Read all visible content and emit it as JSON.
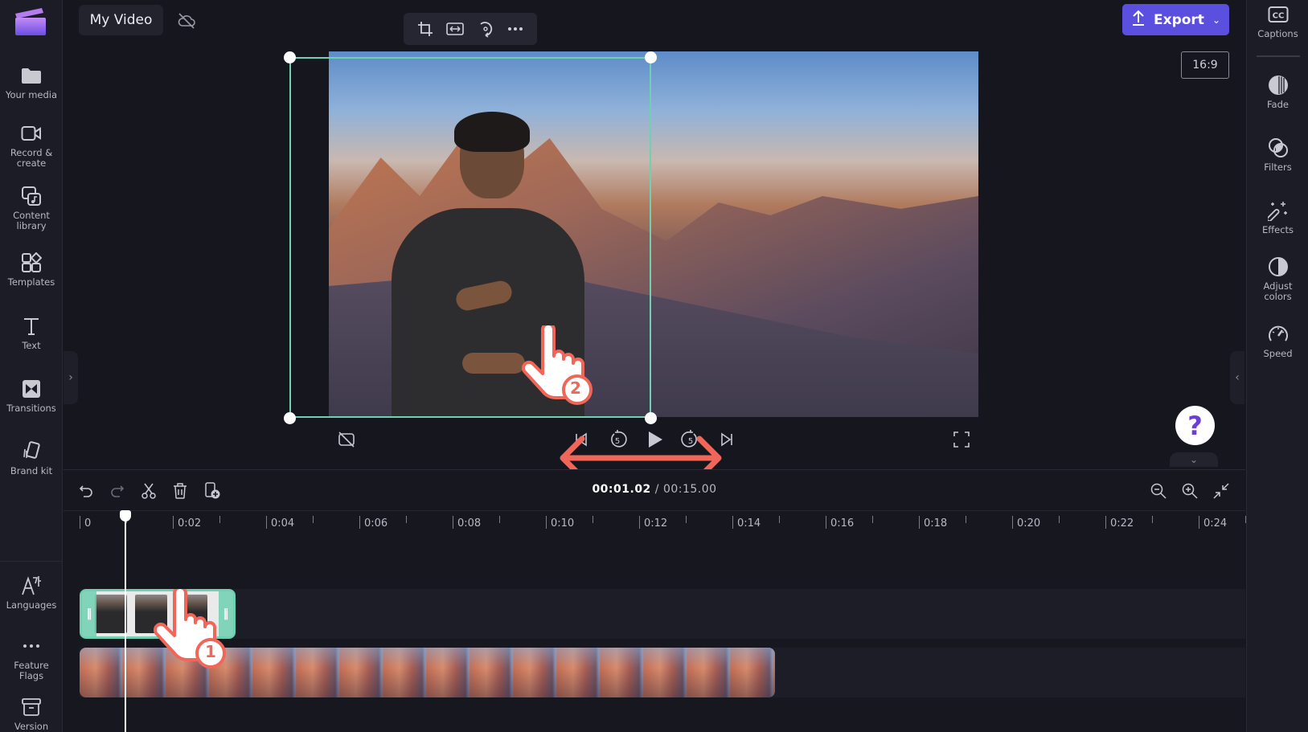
{
  "app": {
    "project_title": "My Video",
    "cloud_status_icon": "cloud-off-icon"
  },
  "left_sidebar": {
    "items": [
      {
        "label": "Your media",
        "icon": "folder-icon"
      },
      {
        "label": "Record &\ncreate",
        "icon": "video-camera-icon"
      },
      {
        "label": "Content\nlibrary",
        "icon": "content-library-icon"
      },
      {
        "label": "Templates",
        "icon": "templates-icon"
      },
      {
        "label": "Text",
        "icon": "text-icon"
      },
      {
        "label": "Transitions",
        "icon": "transitions-icon"
      },
      {
        "label": "Brand kit",
        "icon": "brand-kit-icon"
      },
      {
        "label": "Languages",
        "icon": "languages-icon"
      },
      {
        "label": "Feature\nFlags",
        "icon": "more-icon"
      },
      {
        "label": "Version",
        "icon": "archive-icon"
      }
    ]
  },
  "right_sidebar": {
    "items": [
      {
        "label": "Captions",
        "icon": "captions-icon"
      },
      {
        "label": "Fade",
        "icon": "fade-icon"
      },
      {
        "label": "Filters",
        "icon": "filters-icon"
      },
      {
        "label": "Effects",
        "icon": "effects-icon"
      },
      {
        "label": "Adjust\ncolors",
        "icon": "adjust-colors-icon"
      },
      {
        "label": "Speed",
        "icon": "speed-icon"
      }
    ]
  },
  "floating_toolbar": {
    "tools": [
      "crop-icon",
      "fit-icon",
      "rotate-icon",
      "more-icon"
    ]
  },
  "header": {
    "export_label": "Export",
    "aspect_ratio": "16:9"
  },
  "playback": {
    "current_time": "00:01.02",
    "separator": " / ",
    "total_time": "00:15.00",
    "skip_seconds": "5"
  },
  "timeline": {
    "ruler_labels": [
      "0",
      "0:02",
      "0:04",
      "0:06",
      "0:08",
      "0:10",
      "0:12",
      "0:14",
      "0:16",
      "0:18",
      "0:20",
      "0:22",
      "0:24"
    ],
    "tools": [
      "undo-icon",
      "redo-icon",
      "split-icon",
      "delete-icon",
      "add-to-library-icon"
    ],
    "zoom_tools": [
      "zoom-out-icon",
      "zoom-in-icon",
      "fit-timeline-icon"
    ]
  },
  "annotations": {
    "step1": "1",
    "step2": "2",
    "accent_color": "#f0675a"
  },
  "help": {
    "label": "?"
  },
  "colors": {
    "accent": "#5b4fe0",
    "selection": "#6fd1b1",
    "background": "#16161e"
  }
}
